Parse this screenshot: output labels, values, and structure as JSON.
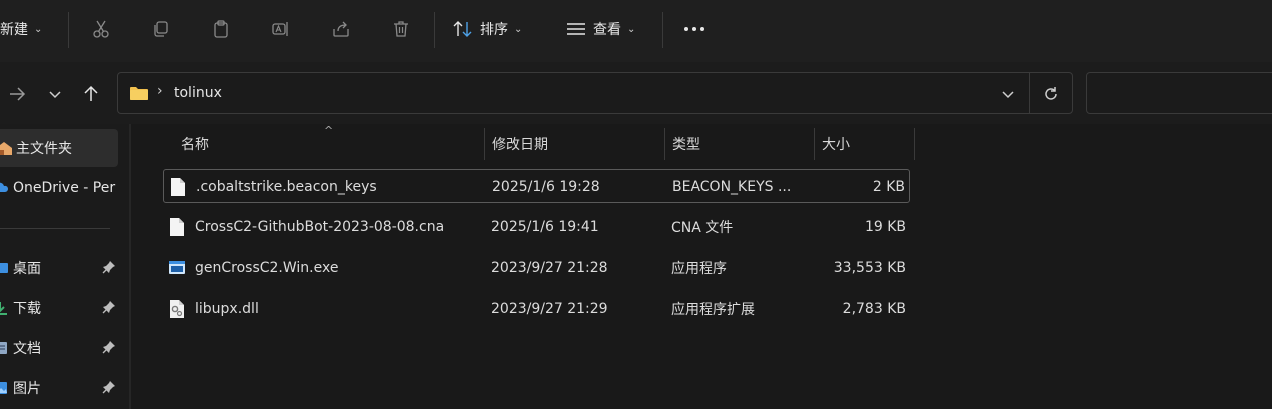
{
  "toolbar": {
    "new_label": "新建",
    "sort_label": "排序",
    "view_label": "查看",
    "icons": [
      "cut-icon",
      "copy-icon",
      "paste-icon",
      "rename-icon",
      "share-icon",
      "delete-icon",
      "more-icon"
    ]
  },
  "address": {
    "path_segment": "tolinux"
  },
  "sidebar": {
    "items": [
      {
        "label": "主文件夹",
        "icon": "home-icon"
      },
      {
        "label": "OneDrive - Per",
        "icon": "cloud-icon"
      },
      {
        "label": "桌面",
        "icon": "desktop-icon",
        "pinned": true
      },
      {
        "label": "下载",
        "icon": "download-icon",
        "pinned": true
      },
      {
        "label": "文档",
        "icon": "documents-icon",
        "pinned": true
      },
      {
        "label": "图片",
        "icon": "pictures-icon",
        "pinned": true
      }
    ]
  },
  "columns": {
    "name": "名称",
    "modified": "修改日期",
    "type": "类型",
    "size": "大小"
  },
  "files": [
    {
      "name": ".cobaltstrike.beacon_keys",
      "modified": "2025/1/6 19:28",
      "type": "BEACON_KEYS ...",
      "size": "2 KB",
      "icon": "file-icon"
    },
    {
      "name": "CrossC2-GithubBot-2023-08-08.cna",
      "modified": "2025/1/6 19:41",
      "type": "CNA 文件",
      "size": "19 KB",
      "icon": "file-icon"
    },
    {
      "name": "genCrossC2.Win.exe",
      "modified": "2023/9/27 21:28",
      "type": "应用程序",
      "size": "33,553 KB",
      "icon": "exe-icon"
    },
    {
      "name": "libupx.dll",
      "modified": "2023/9/27 21:29",
      "type": "应用程序扩展",
      "size": "2,783 KB",
      "icon": "dll-icon"
    }
  ],
  "colors": {
    "accent": "#4ea1e6",
    "folder": "#f2c14e"
  }
}
